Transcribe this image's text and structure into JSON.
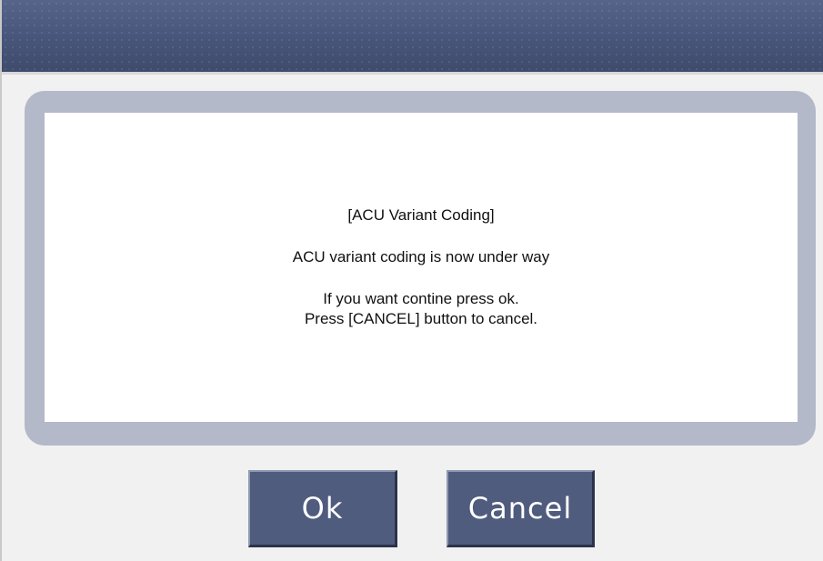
{
  "dialog": {
    "title_line": "[ACU Variant Coding]",
    "status_line": "ACU variant coding is now under way",
    "instruction_line_1": "If you want contine press ok.",
    "instruction_line_2": "Press [CANCEL] button to cancel."
  },
  "buttons": {
    "ok_label": "Ok",
    "cancel_label": "Cancel"
  },
  "colors": {
    "title_bar": "#4a5878",
    "button": "#4f5c7e",
    "frame": "#b4b9c9",
    "panel": "#ffffff"
  }
}
